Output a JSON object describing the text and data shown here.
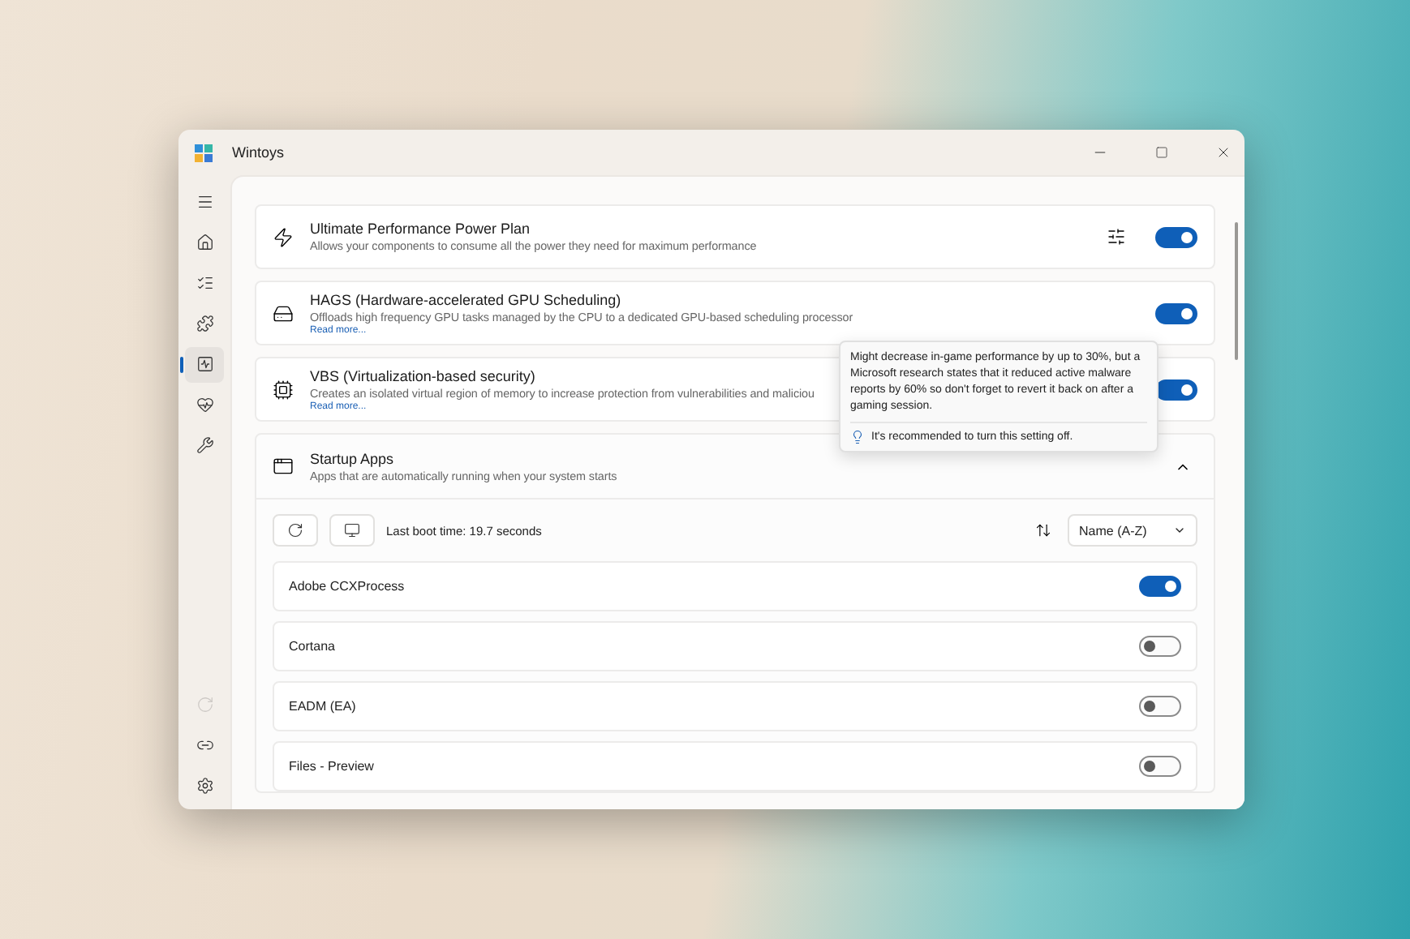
{
  "window": {
    "title": "Wintoys"
  },
  "sidebar": {
    "items": [
      {
        "selected": false
      },
      {
        "selected": false
      },
      {
        "selected": false
      },
      {
        "selected": false
      },
      {
        "selected": true
      },
      {
        "selected": false
      },
      {
        "selected": false
      }
    ],
    "footer_items": [
      {
        "disabled": true
      },
      {
        "disabled": false
      },
      {
        "disabled": false
      }
    ]
  },
  "settings": [
    {
      "kind": "options",
      "title": "Ultimate Performance Power Plan",
      "description": "Allows your components to consume all the power they need for maximum performance",
      "on": true
    },
    {
      "kind": "plain",
      "title": "HAGS (Hardware-accelerated GPU Scheduling)",
      "description": "Offloads high frequency GPU tasks managed by the CPU to a dedicated GPU-based scheduling processor",
      "read_more": "Read more...",
      "on": true
    },
    {
      "kind": "plain",
      "title": "VBS (Virtualization-based security)",
      "description": "Creates an isolated virtual region of memory to increase protection from vulnerabilities and maliciou",
      "read_more": "Read more...",
      "on": true
    }
  ],
  "startup": {
    "title": "Startup Apps",
    "description": "Apps that are automatically running when your system starts",
    "expanded": true,
    "last_boot": "Last boot time: 19.7 seconds",
    "sort": "Name (A-Z)",
    "apps": [
      {
        "name": "Adobe CCXProcess",
        "on": true
      },
      {
        "name": "Cortana",
        "on": false
      },
      {
        "name": "EADM (EA)",
        "on": false
      },
      {
        "name": "Files - Preview",
        "on": false
      }
    ]
  },
  "tooltip": {
    "text": "Might decrease in-game performance by up to 30%, but a Microsoft research states that it reduced active malware reports by 60% so don't forget to revert it back on after a gaming session.",
    "note": "It's recommended to turn this setting off."
  }
}
